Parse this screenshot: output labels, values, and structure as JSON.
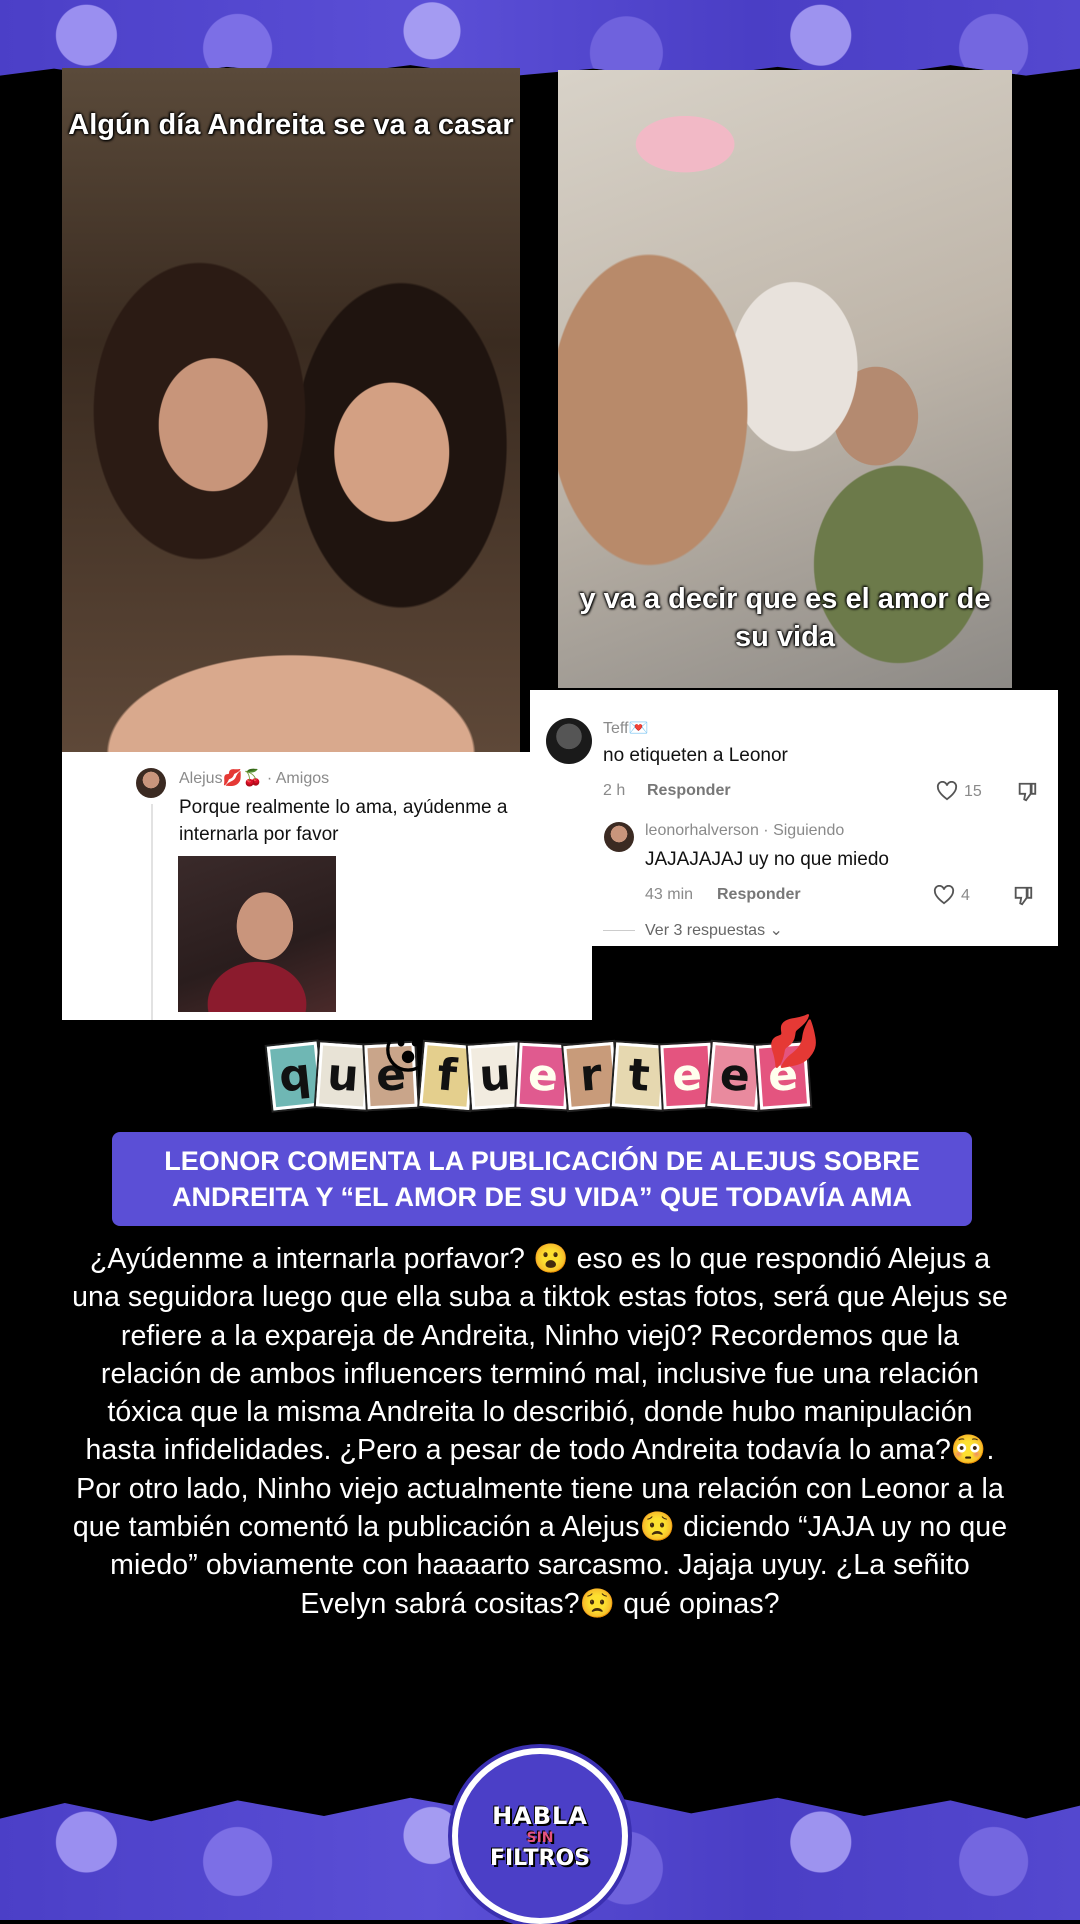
{
  "left_photo": {
    "caption": "Algún día Andreita se va a casar"
  },
  "right_photo": {
    "caption": "y va a decir que es el amor de su vida"
  },
  "left_comment": {
    "user": "Alejus💋🍒 · Amigos",
    "text": "Porque realmente lo ama, ayúdenme a internarla por favor"
  },
  "right_comment": {
    "user": "Teff💌",
    "text": "no etiqueten a Leonor",
    "time": "2 h",
    "reply_label": "Responder",
    "likes": "15",
    "reply": {
      "user": "leonorhalverson · Siguiendo",
      "text": "JAJAJAJAJ uy no que miedo",
      "time": "43 min",
      "reply_label": "Responder",
      "likes": "4"
    },
    "view_replies": "Ver 3 respuestas"
  },
  "sticker": {
    "letters": [
      "q",
      "u",
      "e",
      "f",
      "u",
      "e",
      "r",
      "t",
      "e",
      "e",
      "e"
    ],
    "emoji": "😮",
    "kiss": "💋"
  },
  "headline": "LEONOR COMENTA LA PUBLICACIÓN DE ALEJUS SOBRE ANDREITA Y “EL AMOR DE SU VIDA” QUE TODAVÍA AMA",
  "body": "¿Ayúdenme a internarla porfavor? 😮 eso es lo que respondió Alejus a una seguidora luego que ella suba a tiktok estas fotos, será que Alejus se refiere a la expareja de Andreita, Ninho viej0? Recordemos que la relación de ambos influencers terminó mal, inclusive fue una relación tóxica que la misma Andreita lo describió, donde hubo manipulación hasta infidelidades. ¿Pero a pesar de todo Andreita todavía lo ama?😳. Por otro lado, Ninho viejo actualmente tiene una relación con Leonor a la que también comentó la publicación a Alejus😟 diciendo “JAJA uy no que miedo” obviamente con haaaarto sarcasmo. Jajaja uyuy. ¿La señito Evelyn sabrá cositas?😟 qué opinas?",
  "logo": {
    "line1": "HABLA",
    "line2": "SIN",
    "line3": "FILTROS"
  },
  "colors": {
    "brand_purple": "#5b4fd6",
    "banner_purple": "#4b3fc7"
  }
}
